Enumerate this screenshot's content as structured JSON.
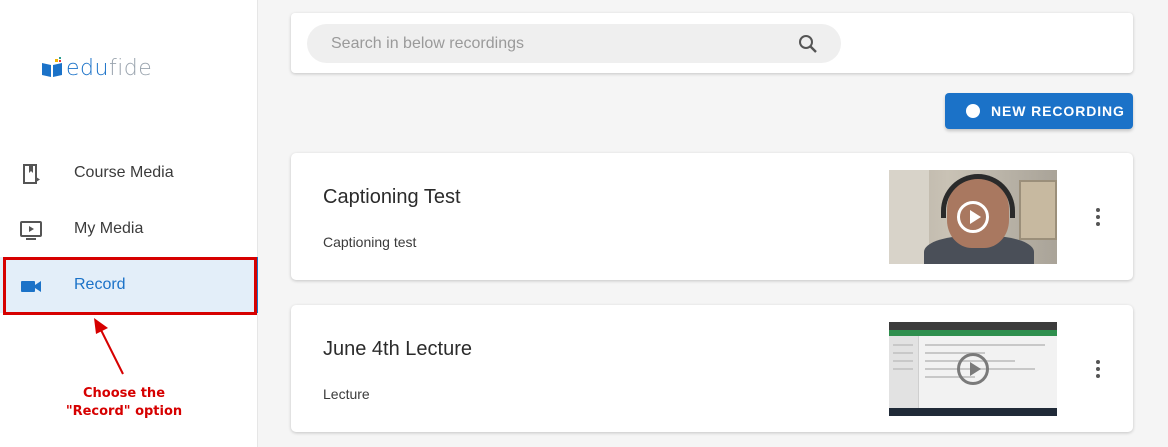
{
  "logo": {
    "text_main": "edu",
    "text_rest": "fide"
  },
  "sidebar": {
    "items": [
      {
        "label": "Course Media",
        "icon": "book-media-icon"
      },
      {
        "label": "My Media",
        "icon": "play-screen-icon"
      },
      {
        "label": "Record",
        "icon": "video-camera-icon",
        "active": true
      }
    ]
  },
  "annotation": {
    "line1": "Choose the",
    "line2": "\"Record\" option"
  },
  "search": {
    "placeholder": "Search in below recordings",
    "value": ""
  },
  "toolbar": {
    "new_recording_label": "NEW RECORDING"
  },
  "recordings": [
    {
      "title": "Captioning Test",
      "description": "Captioning test"
    },
    {
      "title": "June 4th Lecture",
      "description": "Lecture"
    }
  ],
  "colors": {
    "accent": "#1b72c8",
    "annotation_red": "#d60000",
    "background": "#f5f5f5"
  }
}
